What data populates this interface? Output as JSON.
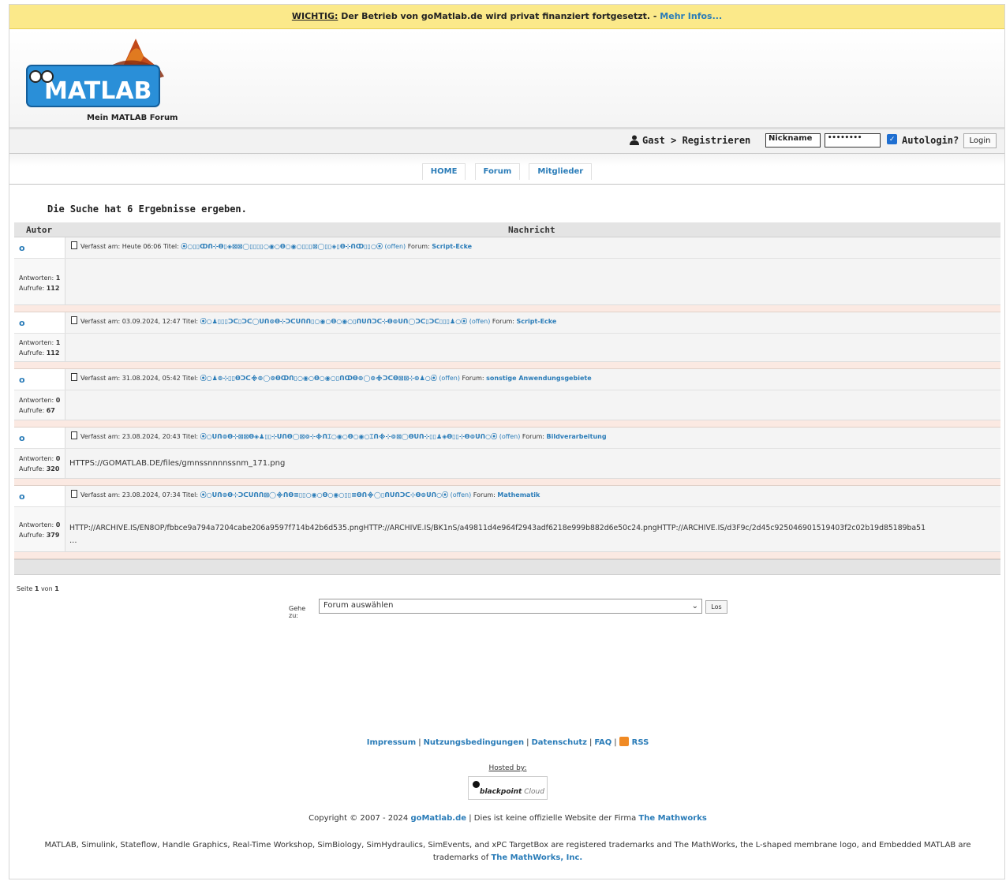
{
  "notice": {
    "important": "WICHTIG:",
    "text": " Der Betrieb von goMatlab.de wird privat finanziert fortgesetzt. - ",
    "more_link": "Mehr Infos..."
  },
  "header": {
    "logo_text": "MATLAB",
    "logo_prefix": "go",
    "caption": "Mein MATLAB Forum"
  },
  "login": {
    "user_text": "Gast > Registrieren",
    "nickname_value": "Nickname",
    "password_value": "••••••••",
    "autologin_label": "Autologin?",
    "login_button": "Login"
  },
  "nav": {
    "tabs": [
      "HOME",
      "Forum",
      "Mitglieder"
    ]
  },
  "results": {
    "title": "Die Suche hat 6 Ergebnisse ergeben.",
    "col_author": "Autor",
    "col_message": "Nachricht"
  },
  "posts": [
    {
      "author": "o",
      "meta_prefix": "Verfasst am: Heute 06:06    Titel:",
      "title": "⦿○▯▯ↀᑎ⊹ϴ▯◈⊠⊠◯▯▯▯▯○◉○ϴ○◉○▯▯▯⊠◯▯▯◈▯ϴ⊹ᑎↀ▯▯○⦿",
      "status": "(offen)",
      "forum_label": "Forum:",
      "forum": "Script-Ecke",
      "replies_label": "Antworten:",
      "replies": "1",
      "views_label": "Aufrufe:",
      "views": "112",
      "body": ""
    },
    {
      "author": "o",
      "meta_prefix": "Verfasst am: 03.09.2024, 12:47    Titel:",
      "title": "⦿○♟▯▯▯ᑐᑕ▯ᑐᑕ◯ᑌᑎ⊚ϴ⊹ᑐᑕᑌᑎᑎ▯○◉○ϴ○◉○▯ᑎᑌᑎᑐᑕ⊹ϴ⊚ᑌᑎ◯ᑐᑕ▯ᑐᑕ▯▯▯♟○⦿",
      "status": "(offen)",
      "forum_label": "Forum:",
      "forum": "Script-Ecke",
      "replies_label": "Antworten:",
      "replies": "1",
      "views_label": "Aufrufe:",
      "views": "112",
      "body": ""
    },
    {
      "author": "o",
      "meta_prefix": "Verfasst am: 31.08.2024, 05:42    Titel:",
      "title": "⦿○♟⊚⊹▯▯ϴᑐᑕ᯽⊚◯⊚ϴↀᑎ▯○◉○ϴ○◉○▯ᑎↀϴ⊚◯⊚᯽ᑐᑕϴ⊠⊠⊹⊚♟○⦿",
      "status": "(offen)",
      "forum_label": "Forum:",
      "forum": "sonstige Anwendungsgebiete",
      "replies_label": "Antworten:",
      "replies": "0",
      "views_label": "Aufrufe:",
      "views": "67",
      "body": ""
    },
    {
      "author": "o",
      "meta_prefix": "Verfasst am: 23.08.2024, 20:43    Titel:",
      "title": "⦿○ᑌᑎ⊚ϴ⊹⊠⊠ϴ◈♟▯▯⊹ᑌᑎϴ◯⊠⊚⊹᯽ᑎ⌶○◉○ϴ○◉○⌶ᑎ᯽⊹⊚⊠◯ϴᑌᑎ⊹▯▯♟◈ϴ▯▯⊹ϴ⊚ᑌᑎ○⦿",
      "status": "(offen)",
      "forum_label": "Forum:",
      "forum": "Bildverarbeitung",
      "replies_label": "Antworten:",
      "replies": "0",
      "views_label": "Aufrufe:",
      "views": "320",
      "body": "HTTPS://GOMATLAB.DE/files/gmnssnnnnssnm_171.png"
    },
    {
      "author": "o",
      "meta_prefix": "Verfasst am: 23.08.2024, 07:34    Titel:",
      "title": "⦿○ᑌᑎ⊚ϴ⊹ᑐᑕᑌᑎᑎ⊠◯᯽ᑎϴ≡▯▯○◉○ϴ○◉○▯▯≡ϴᑎ᯽◯▯ᑎᑌᑎᑐᑕ⊹ϴ⊚ᑌᑎ○⦿",
      "status": "(offen)",
      "forum_label": "Forum:",
      "forum": "Mathematik",
      "replies_label": "Antworten:",
      "replies": "0",
      "views_label": "Aufrufe:",
      "views": "379",
      "body": "HTTP://ARCHIVE.IS/EN8OP/fbbce9a794a7204cabe206a9597f714b42b6d535.pngHTTP://ARCHIVE.IS/BK1nS/a49811d4e964f2943adf6218e999b882d6e50c24.pngHTTP://ARCHIVE.IS/d3F9c/2d45c925046901519403f2c02b19d85189ba51",
      "body2": "..."
    }
  ],
  "pagination": {
    "text_prefix": "Seite ",
    "current": "1",
    "text_mid": " von ",
    "total": "1"
  },
  "goto": {
    "label": "Gehe zu:",
    "selected": "Forum auswählen",
    "button": "Los"
  },
  "footer": {
    "links": [
      "Impressum",
      "Nutzungsbedingungen",
      "Datenschutz",
      "FAQ",
      "RSS"
    ],
    "hosted_by": "Hosted by:",
    "host_brand": "blackpoint",
    "host_suffix": "Cloud",
    "copyright_prefix": "Copyright © 2007 - 2024 ",
    "copyright_site": "goMatlab.de",
    "copyright_mid": " | Dies ist keine offizielle Website der Firma ",
    "copyright_company": "The Mathworks",
    "trademark_text": "MATLAB, Simulink, Stateflow, Handle Graphics, Real-Time Workshop, SimBiology, SimHydraulics, SimEvents, and xPC TargetBox are registered trademarks and The MathWorks, the L-shaped membrane logo, and Embedded MATLAB are trademarks of ",
    "trademark_company": "The MathWorks, Inc."
  }
}
